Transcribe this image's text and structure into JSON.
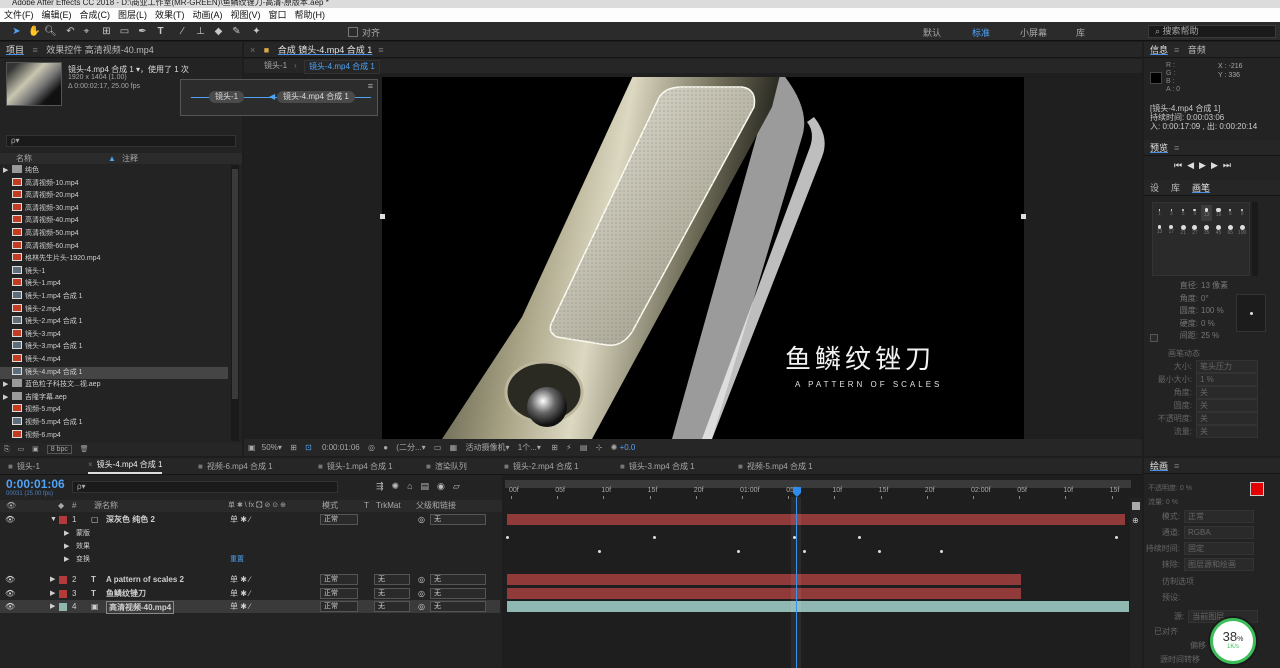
{
  "app": {
    "title": "Adobe After Effects CC 2018 - D:\\商业工作室(MR-GREEN)\\鱼鳞纹锉刀-高清-原版本.aep *"
  },
  "menu": [
    "文件(F)",
    "编辑(E)",
    "合成(C)",
    "图层(L)",
    "效果(T)",
    "动画(A)",
    "视图(V)",
    "窗口",
    "帮助(H)"
  ],
  "toolbar": {
    "align_label": "对齐",
    "workspaces": [
      "默认",
      "标准",
      "小屏幕",
      "库"
    ],
    "active_workspace": "标准",
    "search_placeholder": "搜索帮助"
  },
  "project": {
    "tab_project": "项目",
    "tab_effects": "效果控件 高清视频-40.mp4",
    "item_name": "镜头-4.mp4 合成 1 ▾，使用了 1 次",
    "item_size": "1920 x 1404 (1.00)",
    "item_duration": "Δ 0:00:02:17, 25.00 fps",
    "col_name": "名称",
    "col_note": "注释",
    "items": [
      {
        "name": "纯色",
        "type": "folder"
      },
      {
        "name": "高清视频-10.mp4",
        "type": "video"
      },
      {
        "name": "高清视频-20.mp4",
        "type": "video"
      },
      {
        "name": "高清视频-30.mp4",
        "type": "video"
      },
      {
        "name": "高清视频-40.mp4",
        "type": "video"
      },
      {
        "name": "高清视频-50.mp4",
        "type": "video"
      },
      {
        "name": "高清视频-60.mp4",
        "type": "video"
      },
      {
        "name": "格林先生片头-1920.mp4",
        "type": "video"
      },
      {
        "name": "镜头-1",
        "type": "comp"
      },
      {
        "name": "镜头-1.mp4",
        "type": "video"
      },
      {
        "name": "镜头-1.mp4 合成 1",
        "type": "comp"
      },
      {
        "name": "镜头-2.mp4",
        "type": "video"
      },
      {
        "name": "镜头-2.mp4 合成 1",
        "type": "comp"
      },
      {
        "name": "镜头-3.mp4",
        "type": "video"
      },
      {
        "name": "镜头-3.mp4 合成 1",
        "type": "comp"
      },
      {
        "name": "镜头-4.mp4",
        "type": "video"
      },
      {
        "name": "镜头-4.mp4 合成 1",
        "type": "comp"
      },
      {
        "name": "蓝色粒子科技文...视.aep",
        "type": "folder"
      },
      {
        "name": "吉隆字幕.aep",
        "type": "folder"
      },
      {
        "name": "视频-5.mp4",
        "type": "video"
      },
      {
        "name": "视频-5.mp4 合成 1",
        "type": "comp"
      },
      {
        "name": "视频-6.mp4",
        "type": "video"
      }
    ],
    "bpc": "8 bpc"
  },
  "composition": {
    "tab": "合成 镜头-4.mp4 合成 1",
    "breadcrumbs": [
      "镜头-1",
      "镜头-4.mp4 合成 1"
    ],
    "flow": [
      "镜头-1",
      "镜头-4.mp4 合成 1"
    ],
    "title_cn": "鱼鳞纹锉刀",
    "title_en": "A PATTERN OF SCALES",
    "zoom": "50%",
    "timecode": "0:00:01:06",
    "resolution": "(二分...",
    "camera": "活动摄像机",
    "views": "1个...",
    "exposure": "+0.0"
  },
  "info": {
    "tab_info": "信息",
    "tab_audio": "音频",
    "rgba": [
      "R :",
      "G :",
      "B :",
      "A : 0"
    ],
    "x": "X : -216",
    "y": "Y : 336",
    "comp_name": "[镜头-4.mp4 合成 1]",
    "duration": "持续时间: 0:00:03:06",
    "inout": "入: 0:00:17:09 , 出: 0:00:20:14",
    "preview_label": "预览",
    "brush_tabs": [
      "设",
      "库",
      "画笔"
    ],
    "brush_sizes": [
      "1",
      "3",
      "5",
      "9",
      "13",
      "19",
      "5",
      "9",
      "13",
      "17",
      "21",
      "27",
      "35",
      "45",
      "65",
      "100"
    ],
    "brush_props": [
      {
        "label": "直径:",
        "value": "13 像素"
      },
      {
        "label": "角度:",
        "value": "0°"
      },
      {
        "label": "圆度:",
        "value": "100 %"
      },
      {
        "label": "硬度:",
        "value": "0 %"
      },
      {
        "label": "间距:",
        "value": "25 %"
      }
    ],
    "brush_dynamics": "画笔动态",
    "dyn": [
      {
        "label": "大小:",
        "value": "笔头压力"
      },
      {
        "label": "最小大小:",
        "value": "1 %"
      },
      {
        "label": "角度:",
        "value": "关"
      },
      {
        "label": "圆度:",
        "value": "关"
      },
      {
        "label": "不透明度:",
        "value": "关"
      },
      {
        "label": "流量:",
        "value": "关"
      }
    ]
  },
  "paint": {
    "title": "绘画",
    "opacity": "不透明度: 0 %",
    "flow": "流量: 0 %",
    "mode_label": "模式:",
    "mode": "正常",
    "channel_label": "通道:",
    "channel": "RGBA",
    "duration_label": "持续时间:",
    "duration": "固定",
    "erase_label": "抹除:",
    "erase": "图层源和绘画",
    "clone_label": "仿制选项",
    "preset_label": "预设:",
    "source_label": "源:",
    "source": "当前图层",
    "aligned": "已对齐",
    "offset_label": "偏移",
    "source_time": "源时间转移",
    "perf": "38",
    "perf_unit": "%",
    "perf_rate": "1K/s"
  },
  "timeline": {
    "tabs": [
      "镜头-1",
      "镜头-4.mp4 合成 1",
      "视频-6.mp4 合成 1",
      "镜头-1.mp4 合成 1",
      "渲染队列",
      "镜头-2.mp4 合成 1",
      "镜头-3.mp4 合成 1",
      "视频-5.mp4 合成 1"
    ],
    "active_tab": 1,
    "timecode": "0:00:01:06",
    "frame": "00031 (25.00 fps)",
    "search_placeholder": "ρ▾",
    "col_num": "#",
    "col_source": "源名称",
    "col_switches": "单 ✱ \\ fx 🖸 ⊘ ⊙ ⊕",
    "col_mode": "模式",
    "col_t": "T",
    "col_trkmat": "TrkMat",
    "col_parent": "父级和链接",
    "ruler": [
      "00f",
      "05f",
      "10f",
      "15f",
      "20f",
      "01:00f",
      "05f",
      "10f",
      "15f",
      "20f",
      "02:00f",
      "05f",
      "10f",
      "15f"
    ],
    "layers": [
      {
        "num": "1",
        "name": "深灰色 纯色 2",
        "mode": "正常",
        "trk": "",
        "parent": "无",
        "color": "#b23a3a",
        "type": "solid"
      },
      {
        "num": "2",
        "name": "A pattern of scales 2",
        "mode": "正常",
        "trk": "无",
        "parent": "无",
        "color": "#b23a3a",
        "type": "text"
      },
      {
        "num": "3",
        "name": "鱼鳞纹锉刀",
        "mode": "正常",
        "trk": "无",
        "parent": "无",
        "color": "#b23a3a",
        "type": "text"
      },
      {
        "num": "4",
        "name": "高清视频-40.mp4",
        "mode": "正常",
        "trk": "无",
        "parent": "无",
        "color": "#8fb8b2",
        "type": "video"
      }
    ],
    "sub_props": [
      "蒙版",
      "效果",
      "变换"
    ],
    "reset": "重置"
  },
  "colors": {
    "accent": "#2d8ceb",
    "timecode": "#4fa3f7",
    "red_bar": "#913a3a",
    "teal_bar": "#8fb8b2",
    "playhead": "#2d8ceb"
  }
}
